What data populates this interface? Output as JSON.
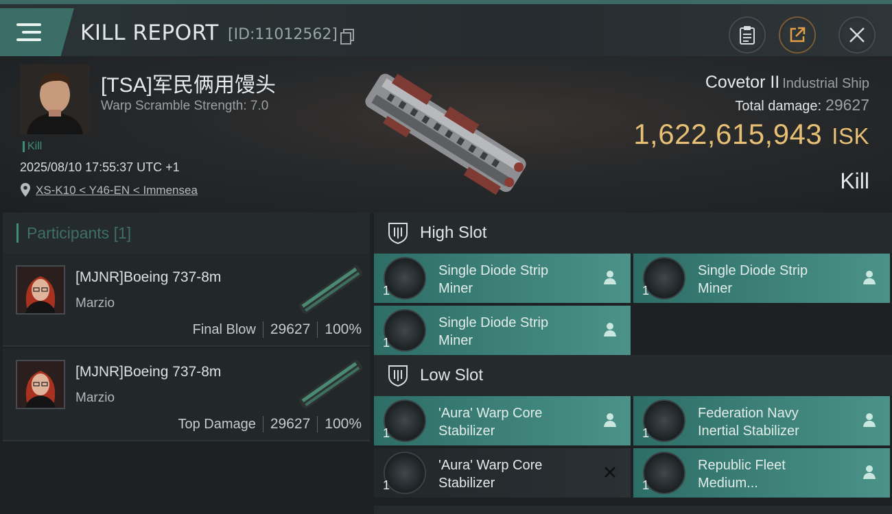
{
  "header": {
    "title": "KILL REPORT",
    "report_id": "[ID:11012562]"
  },
  "victim": {
    "name": "[TSA]军民俩用馒头",
    "warp_scramble": "Warp Scramble Strength: 7.0",
    "kill_tag": "Kill",
    "datetime": "2025/08/10 17:55:37 UTC +1",
    "location": "XS-K10 < Y46-EN < Immensea"
  },
  "ship": {
    "name": "Covetor II",
    "class": "Industrial Ship",
    "total_damage_label": "Total damage:",
    "total_damage": "29627",
    "isk_value": "1,622,615,943",
    "isk_unit": "ISK",
    "result": "Kill"
  },
  "participants": {
    "title": "Participants",
    "count": "[1]",
    "rows": [
      {
        "name": "[MJNR]Boeing 737-8m",
        "corp": "Marzio",
        "role": "Final Blow",
        "damage": "29627",
        "percent": "100%"
      },
      {
        "name": "[MJNR]Boeing 737-8m",
        "corp": "Marzio",
        "role": "Top Damage",
        "damage": "29627",
        "percent": "100%"
      }
    ]
  },
  "fitting": {
    "high_slot": {
      "title": "High Slot",
      "modules": [
        {
          "qty": "1",
          "line1": "Single Diode Strip",
          "line2": "Miner",
          "status": "dropped"
        },
        {
          "qty": "1",
          "line1": "Single Diode Strip",
          "line2": "Miner",
          "status": "dropped"
        },
        {
          "qty": "1",
          "line1": "Single Diode Strip",
          "line2": "Miner",
          "status": "dropped"
        }
      ]
    },
    "low_slot": {
      "title": "Low Slot",
      "modules": [
        {
          "qty": "1",
          "line1": "'Aura' Warp Core",
          "line2": "Stabilizer",
          "status": "dropped"
        },
        {
          "qty": "1",
          "line1": "Federation Navy",
          "line2": "Inertial Stabilizer",
          "status": "dropped"
        },
        {
          "qty": "1",
          "line1": "'Aura' Warp Core",
          "line2": "Stabilizer",
          "status": "destroyed"
        },
        {
          "qty": "1",
          "line1": "Republic Fleet",
          "line2": "Medium...",
          "status": "dropped"
        }
      ]
    }
  },
  "icons": {
    "menu": "menu-icon",
    "copy": "copy-icon",
    "clipboard": "clipboard-icon",
    "share": "share-icon",
    "close": "close-icon",
    "pin": "location-pin-icon",
    "slot": "shield-slot-icon",
    "pilot": "pilot-icon",
    "destroyed": "x-icon"
  },
  "colors": {
    "accent_teal": "#3e8f78",
    "isk_gold": "#e8c075",
    "module_dropped": "#3d7f77"
  }
}
